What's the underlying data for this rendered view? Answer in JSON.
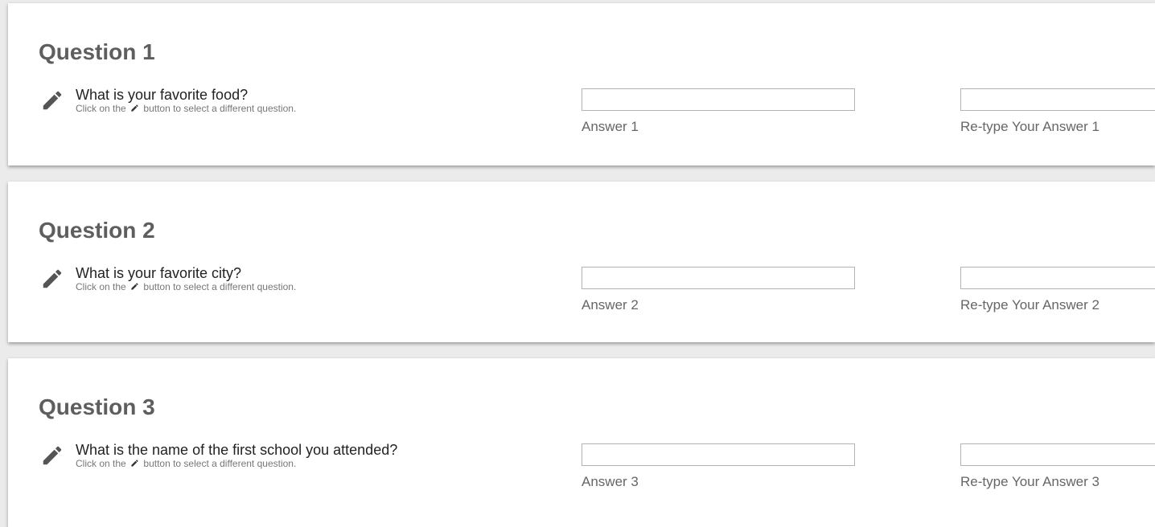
{
  "colors": {
    "background": "#ebebeb",
    "card": "#ffffff",
    "title": "#5e5e5e",
    "icon": "#555555"
  },
  "questions": [
    {
      "title": "Question 1",
      "text": "What is your favorite food?",
      "hint_before": "Click on the",
      "hint_after": "button to select a different question.",
      "edit_icon": "pencil-icon",
      "answer": {
        "label": "Answer 1",
        "value": "",
        "placeholder": ""
      },
      "retype": {
        "label": "Re-type Your Answer 1",
        "value": "",
        "placeholder": ""
      }
    },
    {
      "title": "Question 2",
      "text": "What is your favorite city?",
      "hint_before": "Click on the",
      "hint_after": "button to select a different question.",
      "edit_icon": "pencil-icon",
      "answer": {
        "label": "Answer 2",
        "value": "",
        "placeholder": ""
      },
      "retype": {
        "label": "Re-type Your Answer 2",
        "value": "",
        "placeholder": ""
      }
    },
    {
      "title": "Question 3",
      "text": "What is the name of the first school you attended?",
      "hint_before": "Click on the",
      "hint_after": "button to select a different question.",
      "edit_icon": "pencil-icon",
      "answer": {
        "label": "Answer 3",
        "value": "",
        "placeholder": ""
      },
      "retype": {
        "label": "Re-type Your Answer 3",
        "value": "",
        "placeholder": ""
      }
    }
  ]
}
